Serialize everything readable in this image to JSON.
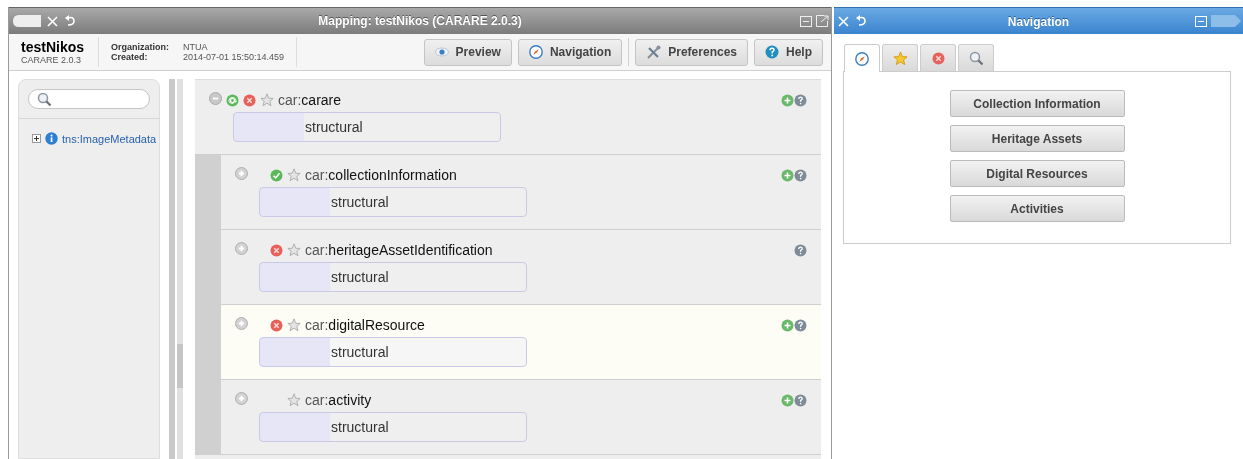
{
  "mapping_window": {
    "title": "Mapping: testNikos (CARARE 2.0.3)",
    "header": {
      "name": "testNikos",
      "version": "CARARE 2.0.3",
      "organization_label": "Organization:",
      "organization": "NTUA",
      "created_label": "Created:",
      "created": "2014-07-01 15:50:14.459"
    },
    "toolbar": [
      {
        "label": "Preview",
        "kind": "eye"
      },
      {
        "label": "Navigation",
        "kind": "compass"
      },
      {
        "label": "Preferences",
        "kind": "tools"
      },
      {
        "label": "Help",
        "kind": "help"
      }
    ],
    "sidebar": {
      "tree": [
        {
          "label": "tns:ImageMetadata",
          "expanded": false
        }
      ]
    },
    "tree": [
      {
        "prefix": "car:",
        "name": "carare",
        "expanded": true,
        "attributes": true,
        "error": true,
        "valid": false,
        "can_add": true,
        "value": "structural",
        "highlighted": false,
        "children": [
          {
            "prefix": "car:",
            "name": "collectionInformation",
            "expanded": false,
            "attributes": false,
            "error": false,
            "valid": true,
            "can_add": true,
            "value": "structural",
            "highlighted": false
          },
          {
            "prefix": "car:",
            "name": "heritageAssetIdentification",
            "expanded": false,
            "attributes": false,
            "error": true,
            "valid": false,
            "can_add": false,
            "value": "structural",
            "highlighted": false
          },
          {
            "prefix": "car:",
            "name": "digitalResource",
            "expanded": false,
            "attributes": false,
            "error": true,
            "valid": false,
            "can_add": true,
            "value": "structural",
            "highlighted": true
          },
          {
            "prefix": "car:",
            "name": "activity",
            "expanded": false,
            "attributes": false,
            "error": false,
            "valid": false,
            "can_add": true,
            "value": "structural",
            "highlighted": false
          }
        ]
      }
    ]
  },
  "navigation_window": {
    "title": "Navigation",
    "tabs": [
      {
        "kind": "compass",
        "selected": true
      },
      {
        "kind": "star",
        "selected": false
      },
      {
        "kind": "error",
        "selected": false
      },
      {
        "kind": "search",
        "selected": false
      }
    ],
    "buttons": [
      "Collection Information",
      "Heritage Assets",
      "Digital Resources",
      "Activities"
    ]
  }
}
